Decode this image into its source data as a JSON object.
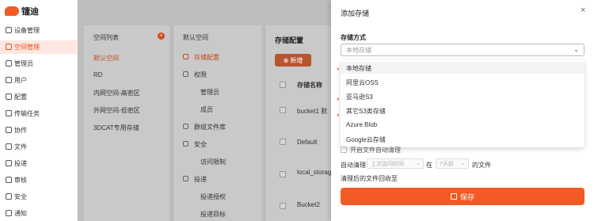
{
  "brand": {
    "name": "镭迪"
  },
  "nav": {
    "items": [
      {
        "label": "设备管理",
        "icon": "list-icon"
      },
      {
        "label": "空间管理",
        "icon": "globe-icon",
        "active": true
      },
      {
        "label": "管理员",
        "icon": "admin-icon"
      },
      {
        "label": "用户",
        "icon": "user-icon"
      },
      {
        "label": "配置",
        "icon": "sliders-icon"
      },
      {
        "label": "传输任务",
        "icon": "transfer-icon"
      },
      {
        "label": "协作",
        "icon": "collab-icon"
      },
      {
        "label": "文件",
        "icon": "file-icon"
      },
      {
        "label": "投递",
        "icon": "send-icon"
      },
      {
        "label": "审核",
        "icon": "audit-icon"
      },
      {
        "label": "安全",
        "icon": "shield-icon"
      },
      {
        "label": "通知",
        "icon": "bell-icon"
      }
    ]
  },
  "spaces": {
    "title": "空间列表",
    "badge": "+",
    "items": [
      "默认空间",
      "RD",
      "内网空间-高密区",
      "外网空间-低密区",
      "3DCAT专用存储"
    ]
  },
  "settings": {
    "title": "默认空间",
    "items": [
      {
        "label": "存储配置",
        "indent": false,
        "active": true
      },
      {
        "label": "权限",
        "indent": false
      },
      {
        "label": "管理员",
        "indent": true
      },
      {
        "label": "成员",
        "indent": true
      },
      {
        "label": "群组文件库",
        "indent": false
      },
      {
        "label": "安全",
        "indent": false
      },
      {
        "label": "访问限制",
        "indent": true
      },
      {
        "label": "投递",
        "indent": false
      },
      {
        "label": "投递授权",
        "indent": true
      },
      {
        "label": "投递目标",
        "indent": true
      }
    ]
  },
  "storage": {
    "title": "存储配置",
    "new_button": "新增",
    "col_name": "存储名称",
    "rows": [
      "bucket1",
      "Default",
      "local_storage",
      "Bucket2"
    ],
    "row1_extra": "默"
  },
  "drawer": {
    "title": "添加存储",
    "close": "×",
    "method_label": "存储方式",
    "method_placeholder": "本地存储",
    "options": [
      "本地存储",
      "阿里云OSS",
      "亚马逊S3",
      "其它S3类存储",
      "Azure Blob",
      "Google云存储"
    ],
    "auto_clean_checkbox": "开启文件自动清理",
    "auto_clean_label": "自动清理",
    "auto_clean_select1": "上次访问时间",
    "auto_clean_in": "在",
    "auto_clean_select2": "7天前",
    "auto_clean_files": "的文件",
    "recycle_label": "清理后的文件回收至",
    "save_label": "保存"
  },
  "colors": {
    "accent": "#f15a24",
    "active_bg": "#fde7e0",
    "overlay": "#bdbdbd"
  }
}
